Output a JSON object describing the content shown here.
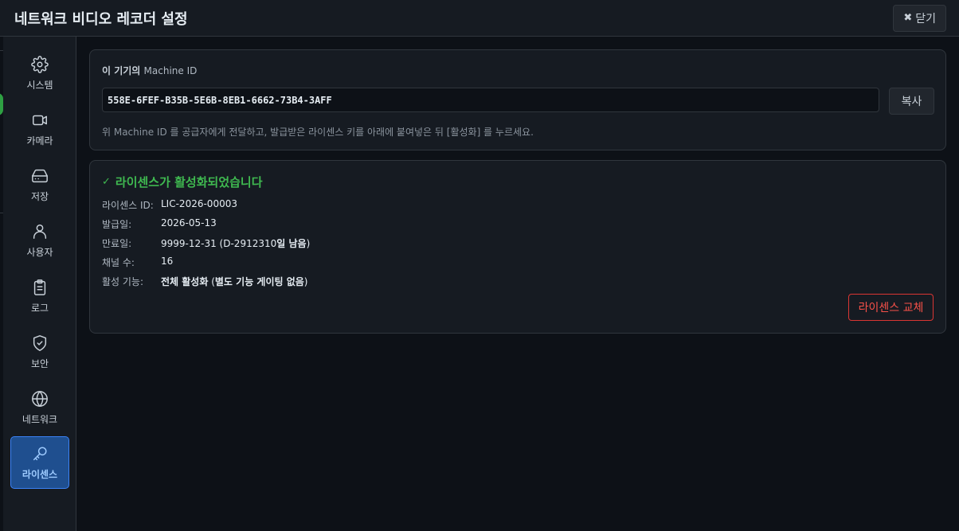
{
  "header": {
    "title": "네트워크 비디오 레코더 설정",
    "close_label": "닫기",
    "close_glyph": "✖"
  },
  "sidebar": {
    "items": [
      {
        "label": "시스템",
        "icon": "gear-icon"
      },
      {
        "label": "카메라",
        "icon": "video-camera-icon"
      },
      {
        "label": "저장",
        "icon": "hard-drive-icon"
      },
      {
        "label": "사용자",
        "icon": "user-icon"
      },
      {
        "label": "로그",
        "icon": "clipboard-icon"
      },
      {
        "label": "보안",
        "icon": "shield-check-icon"
      },
      {
        "label": "네트워크",
        "icon": "globe-icon"
      },
      {
        "label": "라이센스",
        "icon": "key-icon"
      }
    ],
    "active_index": 7,
    "active_color": "#1f4f8f"
  },
  "machine": {
    "label_main": "이 기기의",
    "label_sub": "Machine ID",
    "value": "558E-6FEF-B35B-5E6B-8EB1-6662-73B4-3AFF",
    "copy_label": "복사",
    "hint": "위 Machine ID 를 공급자에게 전달하고, 발급받은 라이센스 키를 아래에 붙여넣은 뒤 [활성화] 를 누르세요."
  },
  "license": {
    "status_check": "✓",
    "status": "라이센스가 활성화되었습니다",
    "status_color": "#3fb950",
    "rows": [
      {
        "key": "라이센스 ID:",
        "value": "LIC-2026-00003"
      },
      {
        "key": "발급일:",
        "value": "2026-05-13"
      },
      {
        "key": "만료일:",
        "value_pre": "9999-12-31 (D-2912310",
        "value_bold": "일 남음",
        "value_post": ")"
      },
      {
        "key": "채널 수:",
        "value": "16"
      },
      {
        "key": "활성 기능:",
        "value_bold": "전체 활성화",
        "value_post": " (",
        "value_bold2": "별도 기능 게이팅 없음",
        "value_post2": ")"
      }
    ],
    "replace_label": "라이센스 교체",
    "replace_color": "#f85149"
  }
}
